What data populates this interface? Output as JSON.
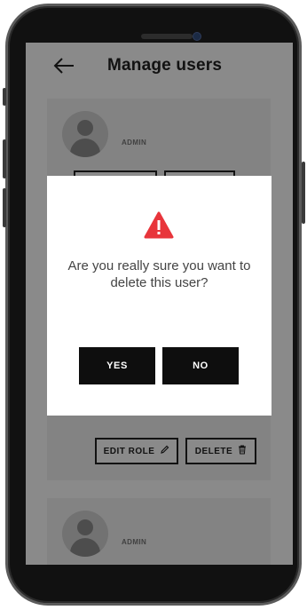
{
  "header": {
    "back_icon": "arrow-left-icon",
    "title": "Manage users"
  },
  "users": [
    {
      "role": "ADMIN",
      "edit_label": "EDIT ROLE",
      "edit_icon": "pencil-icon",
      "delete_label": "DELETE",
      "delete_icon": "trash-icon"
    },
    {
      "role": "ADMIN"
    }
  ],
  "dialog": {
    "icon": "warning-triangle-icon",
    "icon_color": "#e8353b",
    "message": "Are you really sure you want to delete this user?",
    "yes_label": "YES",
    "no_label": "NO"
  }
}
